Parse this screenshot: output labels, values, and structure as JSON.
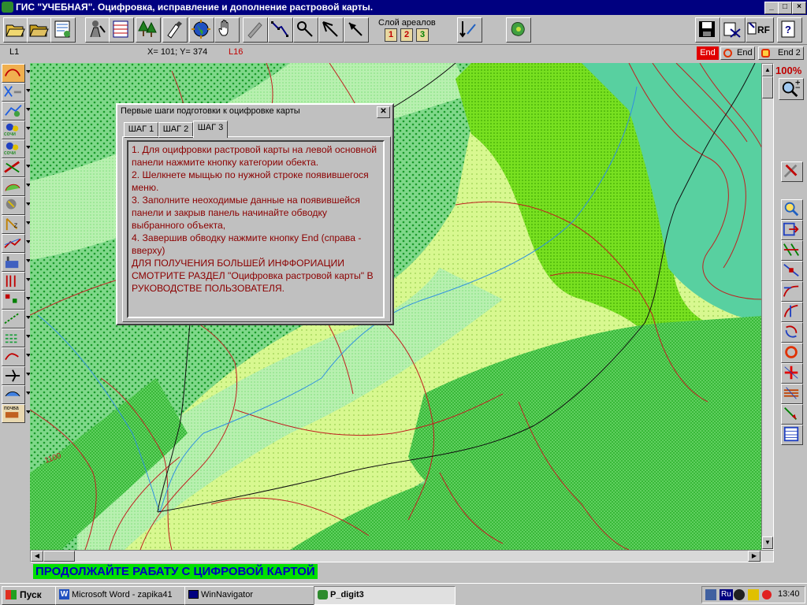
{
  "window": {
    "title": "ГИС \"УЧЕБНАЯ\".  Оцифровка, исправление и дополнение растровой карты.",
    "controls": [
      "_",
      "□",
      "×"
    ]
  },
  "toolbar": {
    "layers_label": "Слой ареалов",
    "layer_buttons": [
      "1",
      "2",
      "3"
    ],
    "rf_label": "RF"
  },
  "status": {
    "layer_left": "L1",
    "coords": "X= 101;  Y= 374",
    "layer_code": "L16",
    "end_red": "End",
    "end_label": "End",
    "end2_label": "End 2",
    "zoom": "100%"
  },
  "left_panel": {
    "labels": [
      "сочи",
      "сочи",
      "почва"
    ]
  },
  "dialog": {
    "title": "Первые  шаги подготовки к оцифровке карты",
    "tabs": [
      "ШАГ 1",
      "ШАГ 2",
      "ШАГ 3"
    ],
    "active_tab": "ШАГ 3",
    "lines": [
      "    1.    Для оцифровки растровой карты на левой основной панели нажмите кнопку категории обекта.",
      "    2.   Шелкнете мыщью по нужной строке появившегося меню.",
      "    3.   Заполните неоходимые данные  на появившейся панели и закрыв панель начинайте обводку выбранного объекта,",
      "    4.   Завершив обводку нажмите кнопку End (справа - вверху)",
      "ДЛЯ ПОЛУЧЕНИЯ БОЛЬШЕЙ ИНФФОРИАЦИИ СМОТРИТЕ РАЗДЕЛ \"Оцифровка растровой карты\" В РУКОВОДСТВЕ ПОЛЬЗОВАТЕЛЯ."
    ]
  },
  "map": {
    "contour_label": "1100"
  },
  "banner": {
    "text": "ПРОДОЛЖАЙТЕ РАБАТУ С ЦИФРОВОЙ КАРТОЙ"
  },
  "taskbar": {
    "start": "Пуск",
    "tasks": [
      "Microsoft Word - zapika41",
      "WinNavigator",
      "P_digit3"
    ],
    "lang": "Ru",
    "clock": "13:40"
  },
  "colors": {
    "title_bar": "#000080",
    "dialog_text": "#8b0000",
    "banner_bg": "#00e000",
    "banner_text": "#0000c0"
  }
}
